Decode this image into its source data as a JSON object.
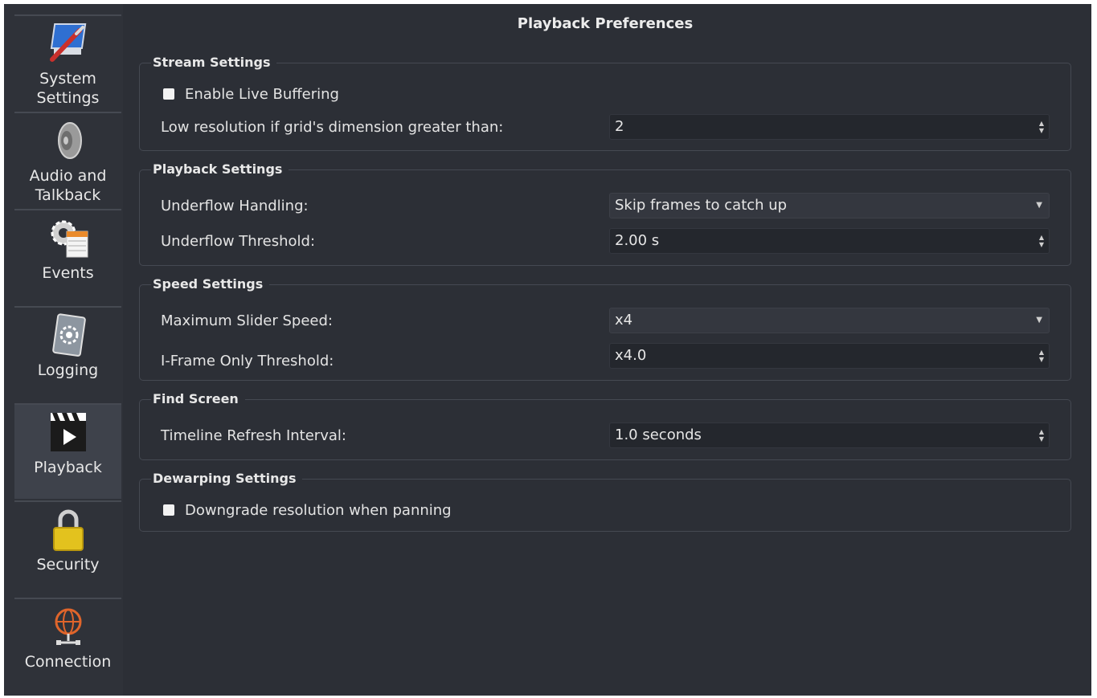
{
  "window": {
    "title": "Playback Preferences"
  },
  "sidebar": {
    "items": [
      {
        "label": "System\nSettings",
        "icon": "system-settings-icon",
        "active": false
      },
      {
        "label": "Audio and\nTalkback",
        "icon": "speaker-icon",
        "active": false
      },
      {
        "label": "Events",
        "icon": "events-icon",
        "active": false
      },
      {
        "label": "Logging",
        "icon": "logging-icon",
        "active": false
      },
      {
        "label": "Playback",
        "icon": "playback-icon",
        "active": true
      },
      {
        "label": "Security",
        "icon": "lock-icon",
        "active": false
      },
      {
        "label": "Connection",
        "icon": "network-globe-icon",
        "active": false
      }
    ]
  },
  "stream_settings": {
    "title": "Stream Settings",
    "live_buffering_label": "Enable Live Buffering",
    "live_buffering_checked": false,
    "low_res_label": "Low resolution if grid's dimension greater than:",
    "low_res_value": "2"
  },
  "playback_settings": {
    "title": "Playback Settings",
    "underflow_handling_label": "Underflow Handling:",
    "underflow_handling_value": "Skip frames to catch up",
    "underflow_threshold_label": "Underflow Threshold:",
    "underflow_threshold_value": "2.00 s"
  },
  "speed_settings": {
    "title": "Speed Settings",
    "max_slider_label": "Maximum Slider Speed:",
    "max_slider_value": "x4",
    "iframe_label": "I-Frame Only Threshold:",
    "iframe_value": "x4.0"
  },
  "find_screen": {
    "title": "Find Screen",
    "timeline_label": "Timeline Refresh Interval:",
    "timeline_value": "1.0 seconds"
  },
  "dewarping_settings": {
    "title": "Dewarping Settings",
    "downgrade_label": "Downgrade resolution when panning",
    "downgrade_checked": false
  },
  "colors": {
    "background": "#2c2f36",
    "sidebar_active": "#3e424b",
    "field_bg": "#24272d",
    "text": "#e6e6e6"
  }
}
